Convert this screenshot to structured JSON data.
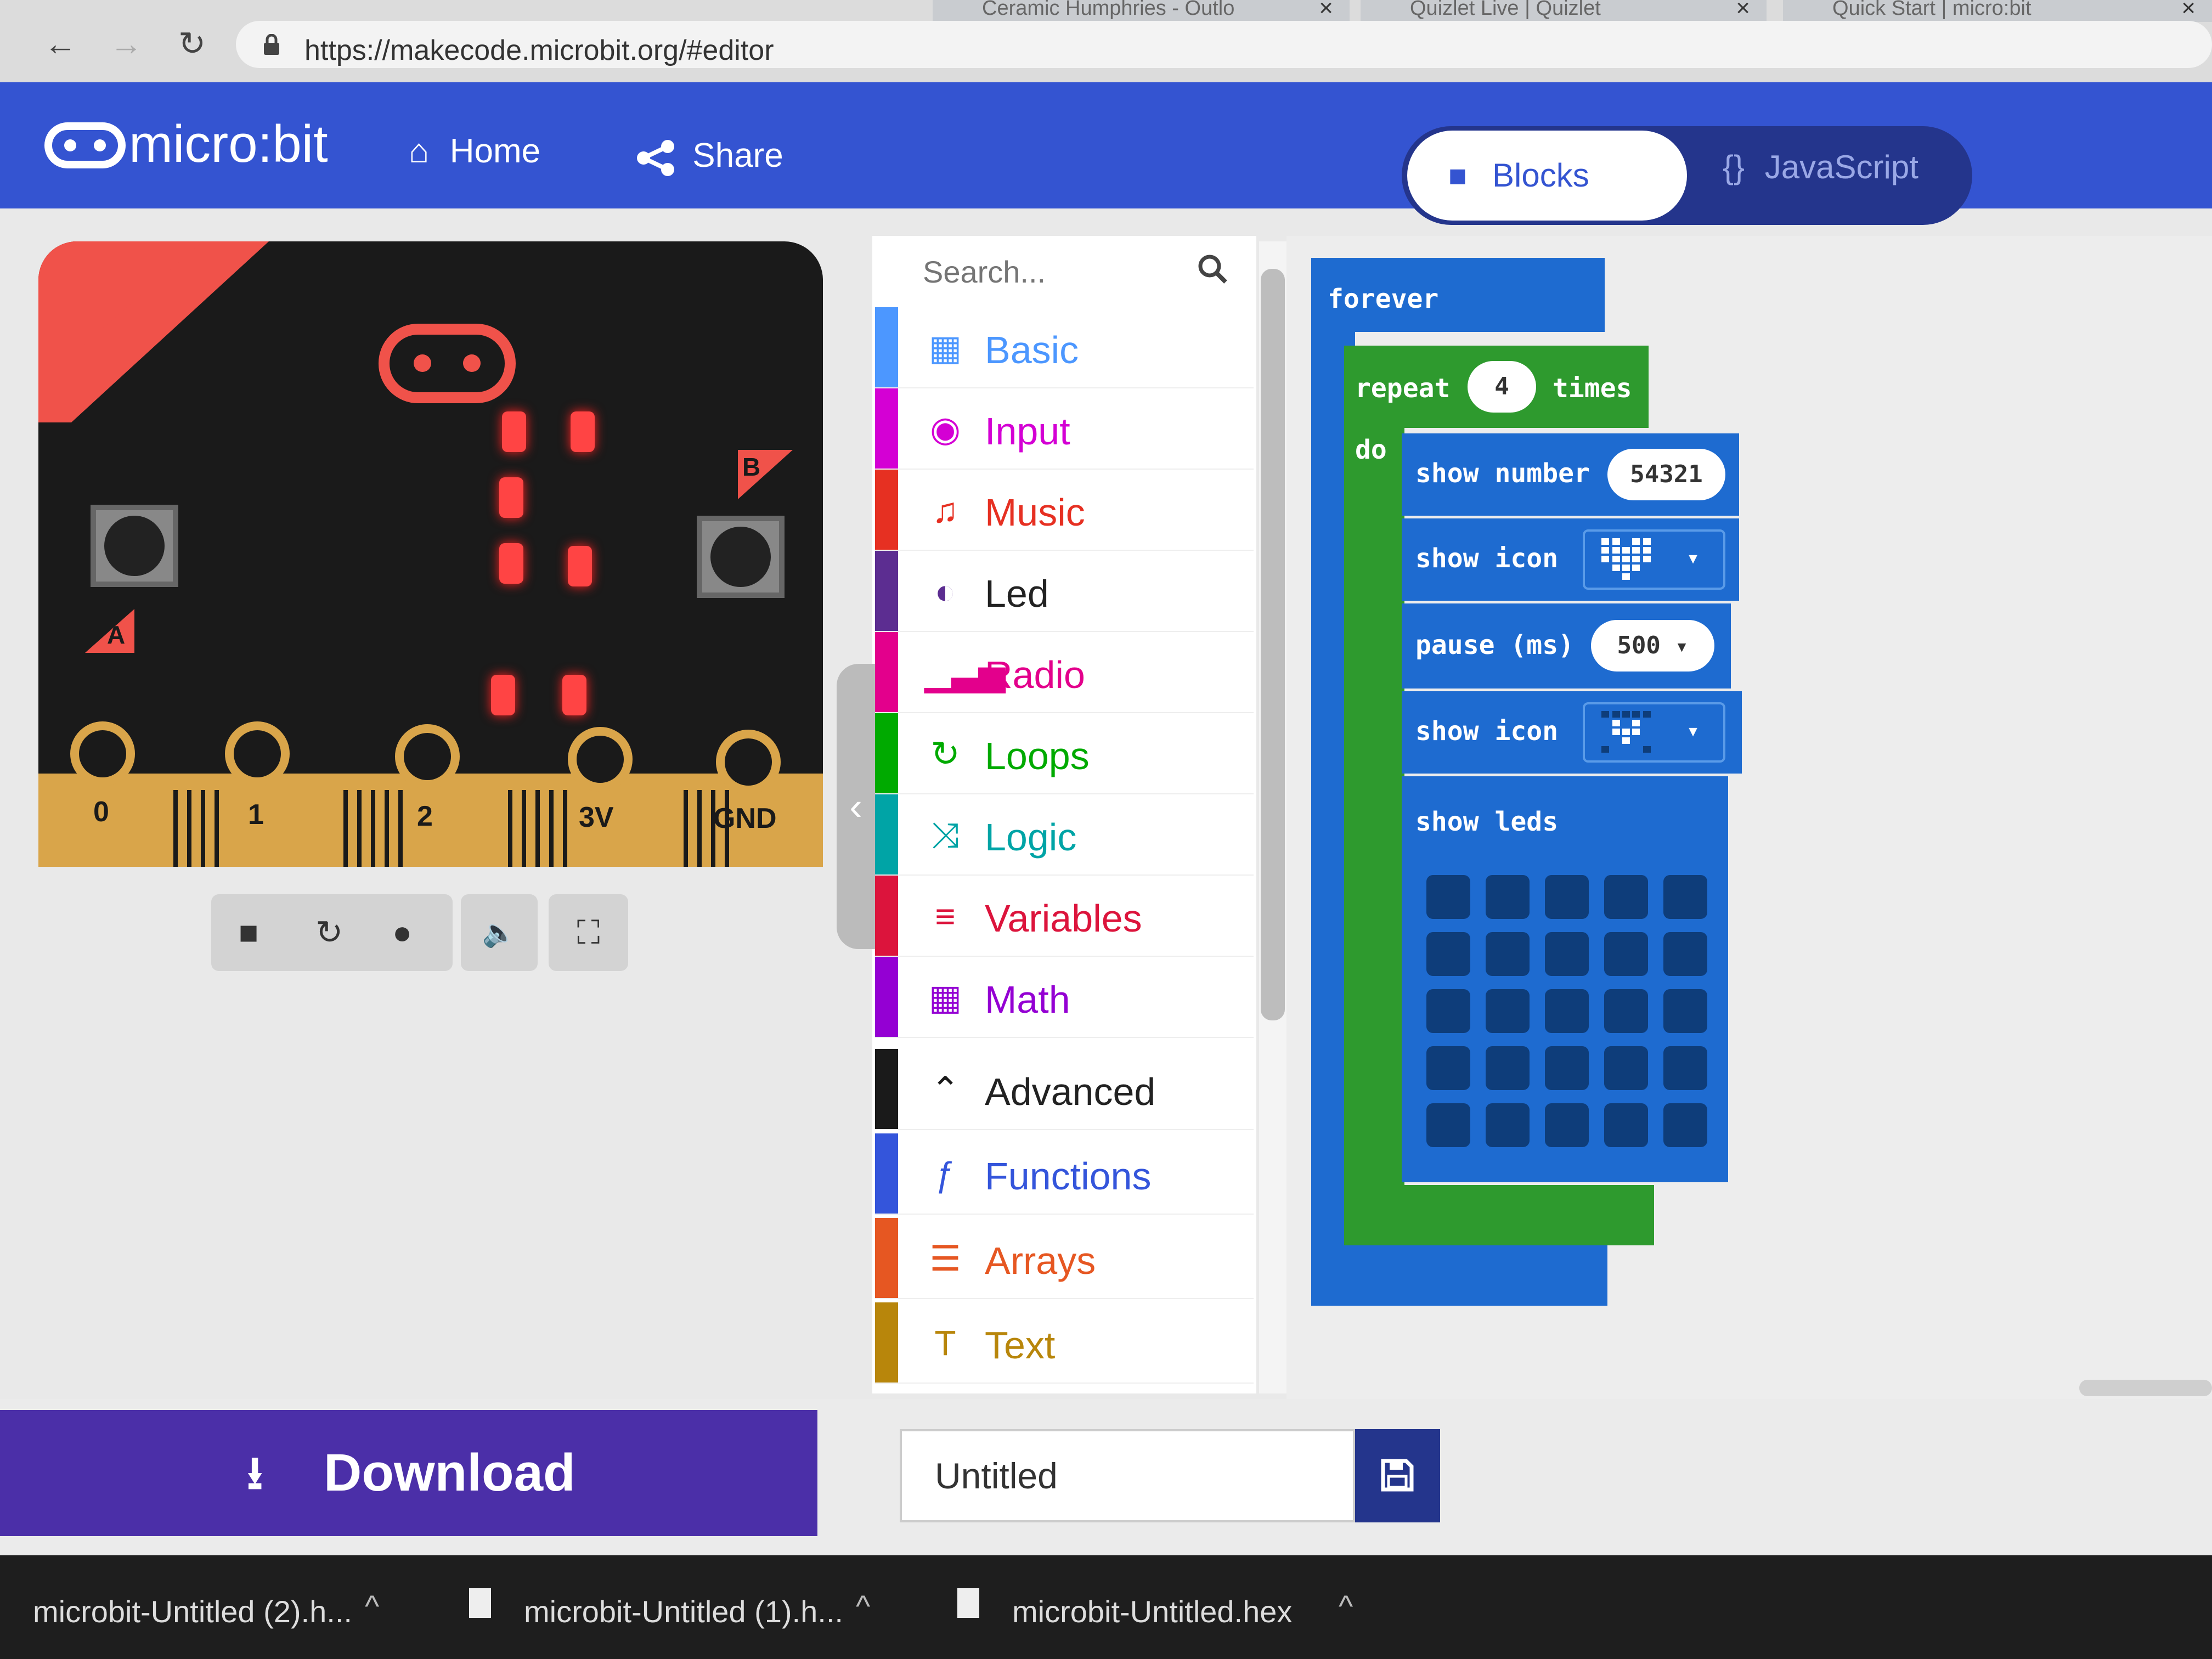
{
  "browser": {
    "tabs": [
      {
        "label": "Ceramic Humphries - Outlo"
      },
      {
        "label": "Quizlet Live | Quizlet"
      },
      {
        "label": "Quick Start | micro:bit"
      }
    ],
    "url": "https://makecode.microbit.org/#editor"
  },
  "header": {
    "logo_text": "micro:bit",
    "home_label": "Home",
    "share_label": "Share",
    "blocks_label": "Blocks",
    "javascript_label": "JavaScript",
    "javascript_icon": "{}"
  },
  "simulator": {
    "pins": [
      "0",
      "1",
      "2",
      "3V",
      "GND"
    ],
    "button_a": "A",
    "button_b": "B",
    "controls": [
      "stop-icon",
      "restart-icon",
      "debug-icon",
      "sound-icon",
      "fullscreen-icon"
    ]
  },
  "toolbox": {
    "search_placeholder": "Search...",
    "categories": [
      {
        "label": "Basic",
        "color": "#4c97ff"
      },
      {
        "label": "Input",
        "color": "#d400d4"
      },
      {
        "label": "Music",
        "color": "#e63022"
      },
      {
        "label": "Led",
        "color": "#5c2d91"
      },
      {
        "label": "Radio",
        "color": "#e3008c"
      },
      {
        "label": "Loops",
        "color": "#00aa00"
      },
      {
        "label": "Logic",
        "color": "#00a4a6"
      },
      {
        "label": "Variables",
        "color": "#dc143c"
      },
      {
        "label": "Math",
        "color": "#9400d3"
      },
      {
        "label": "Advanced",
        "color": "#1a1a1a"
      },
      {
        "label": "Functions",
        "color": "#3455db"
      },
      {
        "label": "Arrays",
        "color": "#e65722"
      },
      {
        "label": "Text",
        "color": "#b8860b"
      }
    ]
  },
  "workspace": {
    "forever": "forever",
    "repeat": "repeat",
    "repeat_count": "4",
    "times": "times",
    "do": "do",
    "show_number": "show number",
    "number_value": "54321",
    "show_icon": "show icon",
    "pause": "pause (ms)",
    "pause_value": "500",
    "show_leds": "show leds"
  },
  "footer": {
    "download_label": "Download",
    "project_name": "Untitled"
  },
  "downloads": [
    {
      "label": "microbit-Untitled (2).h..."
    },
    {
      "label": "microbit-Untitled (1).h..."
    },
    {
      "label": "microbit-Untitled.hex"
    }
  ]
}
